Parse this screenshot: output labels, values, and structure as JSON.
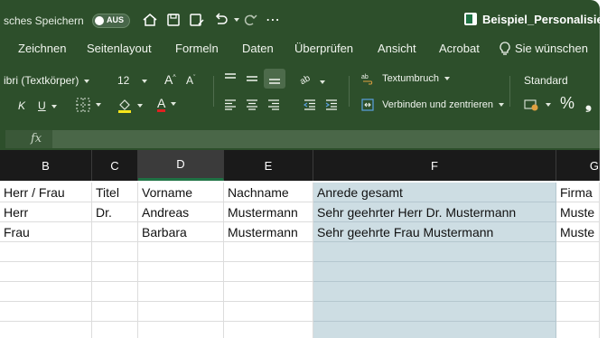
{
  "titlebar": {
    "autosave_label": "sches Speichern",
    "autosave_state": "AUS",
    "document_title": "Beispiel_Personalisie"
  },
  "tabs": [
    "Zeichnen",
    "Seitenlayout",
    "Formeln",
    "Daten",
    "Überprüfen",
    "Ansicht",
    "Acrobat",
    "Sie wünschen"
  ],
  "ribbon": {
    "font_name": "ibri (Textkörper)",
    "font_size": "12",
    "wrap_text": "Textumbruch",
    "merge_center": "Verbinden und zentrieren",
    "number_format": "Standard",
    "percent_symbol": "%"
  },
  "formula_bar": {
    "fx_label": "fx",
    "value": ""
  },
  "columns": [
    "B",
    "C",
    "D",
    "E",
    "F",
    "G"
  ],
  "rows": [
    [
      "Herr / Frau",
      "Titel",
      "Vorname",
      "Nachname",
      "Anrede gesamt",
      "Firma"
    ],
    [
      "Herr",
      "Dr.",
      "Andreas",
      "Mustermann",
      "Sehr geehrter Herr Dr. Mustermann",
      "Muste"
    ],
    [
      "Frau",
      "",
      "Barbara",
      "Mustermann",
      "Sehr geehrte Frau Mustermann",
      "Muste"
    ],
    [
      "",
      "",
      "",
      "",
      "",
      ""
    ],
    [
      "",
      "",
      "",
      "",
      "",
      ""
    ],
    [
      "",
      "",
      "",
      "",
      "",
      ""
    ],
    [
      "",
      "",
      "",
      "",
      "",
      ""
    ],
    [
      "",
      "",
      "",
      "",
      "",
      ""
    ]
  ],
  "colors": {
    "ribbon": "#2d4f2b",
    "selection": "#cddde3",
    "accent_green": "#1f7244",
    "font_color_red": "#e02020",
    "highlight_yellow": "#f6e51b"
  }
}
